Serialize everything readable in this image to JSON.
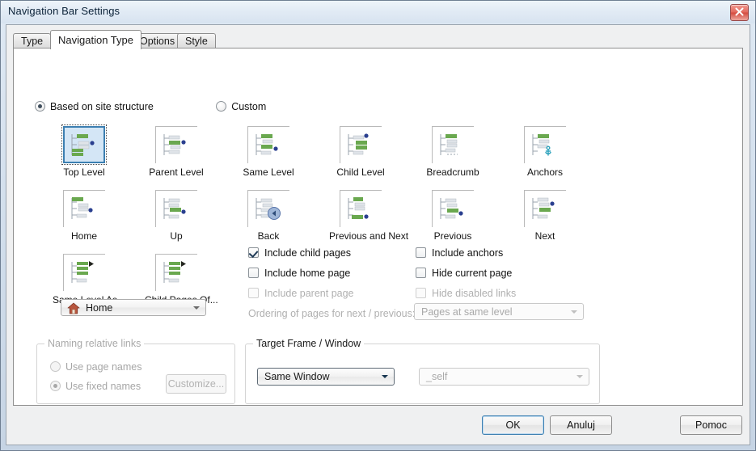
{
  "window": {
    "title": "Navigation Bar Settings",
    "close_icon": "close-icon"
  },
  "tabs": [
    {
      "label": "Type",
      "active": false
    },
    {
      "label": "Navigation Type",
      "active": true
    },
    {
      "label": "Options",
      "active": false
    },
    {
      "label": "Style",
      "active": false
    }
  ],
  "source_mode": {
    "options": [
      {
        "label": "Based on site structure",
        "checked": true
      },
      {
        "label": "Custom",
        "checked": false
      }
    ]
  },
  "nav_types": [
    {
      "label": "Top Level",
      "icon": "tree-top-level-icon",
      "selected": true
    },
    {
      "label": "Parent Level",
      "icon": "tree-parent-level-icon",
      "selected": false
    },
    {
      "label": "Same Level",
      "icon": "tree-same-level-icon",
      "selected": false
    },
    {
      "label": "Child Level",
      "icon": "tree-child-level-icon",
      "selected": false
    },
    {
      "label": "Breadcrumb",
      "icon": "tree-breadcrumb-icon",
      "selected": false
    },
    {
      "label": "Anchors",
      "icon": "tree-anchors-icon",
      "selected": false
    },
    {
      "label": "Home",
      "icon": "tree-home-icon",
      "selected": false
    },
    {
      "label": "Up",
      "icon": "tree-up-icon",
      "selected": false
    },
    {
      "label": "Back",
      "icon": "tree-back-icon",
      "selected": false
    },
    {
      "label": "Previous and Next",
      "icon": "tree-previous-next-icon",
      "selected": false
    },
    {
      "label": "Previous",
      "icon": "tree-previous-icon",
      "selected": false
    },
    {
      "label": "Next",
      "icon": "tree-next-icon",
      "selected": false
    },
    {
      "label": "Same Level As...",
      "icon": "tree-same-level-as-icon",
      "selected": false
    },
    {
      "label": "Child Pages Of...",
      "icon": "tree-child-pages-of-icon",
      "selected": false
    }
  ],
  "page_select": {
    "value": "Home",
    "icon": "home-house-icon"
  },
  "options_left": [
    {
      "label": "Include child pages",
      "checked": true,
      "disabled": false
    },
    {
      "label": "Include home page",
      "checked": false,
      "disabled": false
    },
    {
      "label": "Include parent page",
      "checked": false,
      "disabled": true
    }
  ],
  "options_right": [
    {
      "label": "Include anchors",
      "checked": false,
      "disabled": false
    },
    {
      "label": "Hide current page",
      "checked": false,
      "disabled": false
    },
    {
      "label": "Hide disabled links",
      "checked": false,
      "disabled": true
    }
  ],
  "ordering": {
    "label": "Ordering of pages for next / previous:",
    "value": "Pages at same level",
    "disabled": true
  },
  "naming_group": {
    "title": "Naming relative links",
    "options": [
      {
        "label": "Use page names",
        "checked": false
      },
      {
        "label": "Use fixed names",
        "checked": true
      }
    ],
    "customize_label": "Customize..."
  },
  "target_group": {
    "title": "Target Frame / Window",
    "window_value": "Same Window",
    "frame_value": "_self"
  },
  "footer": {
    "ok_label": "OK",
    "cancel_label": "Anuluj",
    "help_label": "Pomoc"
  },
  "colors": {
    "accent": "#3c7fb1",
    "selection_fill": "#d4e6f6",
    "tree_green": "#6aa84f",
    "tree_blue_dot": "#2a3f8f",
    "anchor_cyan": "#2fa3bd",
    "close_red": "#d44a3e"
  }
}
